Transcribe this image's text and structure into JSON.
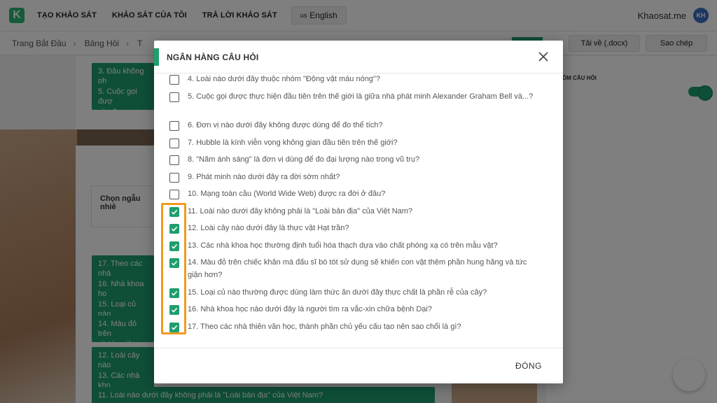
{
  "nav": {
    "logo_letter": "K",
    "items": [
      "TẠO KHẢO SÁT",
      "KHẢO SÁT CỦA TÔI",
      "TRẢ LỜI KHẢO SÁT"
    ],
    "lang_flag": "us",
    "lang_label": "English",
    "username": "Khaosat.me",
    "avatar_initials": "KH"
  },
  "breadcrumb": {
    "items": [
      "Trang Bắt Đầu",
      "Bảng Hỏi",
      "T"
    ],
    "sep": "›"
  },
  "actions": {
    "download": "Tải về (.docx)",
    "copy": "Sao chép"
  },
  "background": {
    "cards": [
      "3. Đâu không ph",
      "5. Cuộc gọi đượ\nvà...?"
    ],
    "random_label": "Chọn ngẫu nhiê",
    "right_label": "ỎM CÂU HỎI",
    "list": [
      "17. Theo các nhà",
      "16. Nhà khoa ho",
      "15. Loại củ nào",
      "14. Màu đỏ trên\nvà tức giận hơn",
      "12. Loài cây nào",
      "13. Các nhà kho",
      "11. Loài nào dưới đây không phải là \"Loài bản địa\" của Việt Nam?"
    ]
  },
  "modal": {
    "title": "NGÂN HÀNG CÂU HỎI",
    "close_label": "ĐÓNG",
    "questions": [
      {
        "text": "4. Loài nào dưới đây thuộc nhóm \"Động vật máu nóng\"?",
        "checked": false
      },
      {
        "text": "5. Cuộc gọi được thực hiện đầu tiên trên thế giới là giữa nhà phát minh Alexander Graham Bell và...?",
        "checked": false
      },
      {
        "text": "6. Đơn vị nào dưới đây không được dùng để đo thể tích?",
        "checked": false
      },
      {
        "text": "7. Hubble là kính viễn vọng không gian đầu tiên trên thế giới?",
        "checked": false
      },
      {
        "text": "8. \"Năm ánh sáng\" là đơn vị dùng để đo đại lượng nào trong vũ trụ?",
        "checked": false
      },
      {
        "text": "9. Phát minh nào dưới đây ra đời sớm nhất?",
        "checked": false
      },
      {
        "text": "10. Mạng toàn cầu (World Wide Web) được ra đời ở đâu?",
        "checked": false
      },
      {
        "text": "11. Loài nào dưới đây không phải là \"Loài bản địa\" của Việt Nam?",
        "checked": true
      },
      {
        "text": "12. Loài cây nào dưới đây là thực vật Hạt trần?",
        "checked": true
      },
      {
        "text": "13. Các nhà khoa học thường định tuổi hóa thạch dựa vào chất phóng xạ có trên mẫu vật?",
        "checked": true
      },
      {
        "text": "14. Màu đỏ trên chiếc khăn mà đấu sĩ bò tót sử dụng sẽ khiến con vật thêm phần hung hăng và tức giận hơn?",
        "checked": true
      },
      {
        "text": "15. Loại củ nào thường được dùng làm thức ăn dưới đây thực chất là phần rễ của cây?",
        "checked": true
      },
      {
        "text": "16. Nhà khoa học nào dưới đây là người tìm ra vắc-xin chữa bệnh Dại?",
        "checked": true
      },
      {
        "text": "17. Theo các nhà thiên văn học, thành phần chủ yếu cấu tạo nên sao chổi là gì?",
        "checked": true
      }
    ]
  },
  "colors": {
    "accent": "#1f9e6e",
    "highlight": "#f19a1f"
  }
}
